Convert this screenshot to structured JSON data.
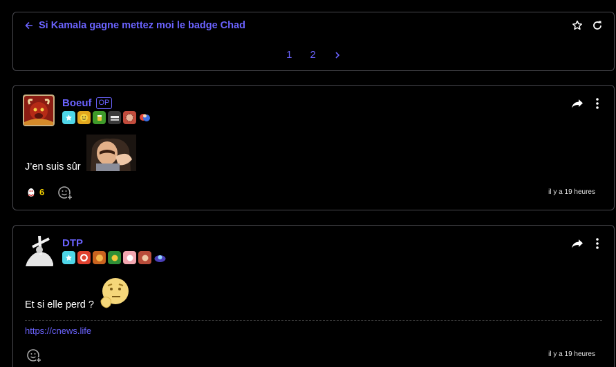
{
  "topic": {
    "title": "Si Kamala gagne mettez moi le badge Chad",
    "pages": [
      "1",
      "2"
    ],
    "icons": [
      "back-arrow-icon",
      "star-icon",
      "refresh-icon",
      "chevron-right-icon"
    ]
  },
  "posts": [
    {
      "author": "Boeuf",
      "op_badge": "OP",
      "text": "J’en suis sûr",
      "reaction_count": "6",
      "time": "il y a 19 heures",
      "colors": {
        "name": "#6b63ff",
        "count": "#f5d200"
      }
    },
    {
      "author": "DTP",
      "text": "Et si elle perd ?",
      "link": "https://cnews.life",
      "time": "il y a 19 heures"
    }
  ]
}
